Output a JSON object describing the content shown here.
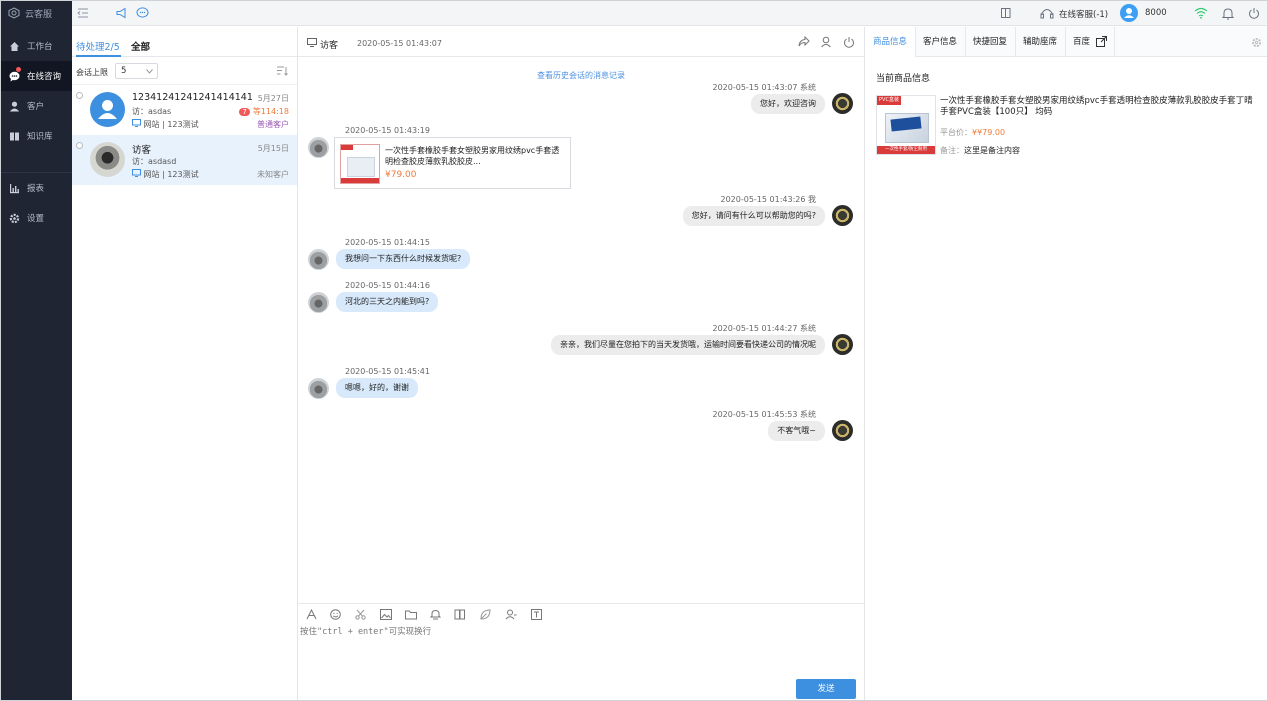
{
  "nav": {
    "brand": "云客服",
    "items": [
      {
        "label": "工作台",
        "icon": "home-icon"
      },
      {
        "label": "在线咨询",
        "icon": "chat-icon"
      },
      {
        "label": "客户",
        "icon": "user-icon"
      },
      {
        "label": "知识库",
        "icon": "book-icon"
      },
      {
        "label": "报表",
        "icon": "chart-icon"
      },
      {
        "label": "设置",
        "icon": "gear-icon"
      }
    ]
  },
  "topbar": {
    "agent_status": "在线客服(-1)",
    "agent_id": "8000"
  },
  "sessions": {
    "tab_pending": "待处理2/5",
    "tab_all": "全部",
    "limit_label": "会话上限",
    "limit_value": "5",
    "items": [
      {
        "name": "12341241241241414141",
        "visitor": "访：asdas",
        "source": "网站 | 123测试",
        "date": "5月27日",
        "badge": "7",
        "wait": "等114:18",
        "type": "普通客户",
        "type_color": "#9b59b6"
      },
      {
        "name": "访客",
        "visitor": "访：asdasd",
        "source": "网站 | 123测试",
        "date": "5月15日",
        "badge": "",
        "wait": "",
        "type": "未知客户",
        "type_color": "#888888"
      }
    ]
  },
  "chat": {
    "title": "访客",
    "started": "2020-05-15 01:43:07",
    "history_link": "查看历史会话的消息记录",
    "messages": [
      {
        "dir": "out",
        "time": "2020-05-15 01:43:07 系统",
        "text": "您好，欢迎咨询"
      },
      {
        "dir": "in",
        "time": "2020-05-15 01:43:19",
        "card": {
          "title": "一次性手套橡胶手套女塑胶男家用纹绣pvc手套透明检查胶皮薄款乳胶胶皮...",
          "price": "¥79.00"
        }
      },
      {
        "dir": "out",
        "time": "2020-05-15 01:43:26 我",
        "text": "您好，请问有什么可以帮助您的吗?"
      },
      {
        "dir": "in",
        "time": "2020-05-15 01:44:15",
        "text": "我想问一下东西什么时候发货呢?"
      },
      {
        "dir": "in",
        "time": "2020-05-15 01:44:16",
        "text": "河北的三天之内能到吗?"
      },
      {
        "dir": "out",
        "time": "2020-05-15 01:44:27 系统",
        "text": "亲亲，我们尽量在您拍下的当天发货哦，运输时间要看快递公司的情况呢"
      },
      {
        "dir": "in",
        "time": "2020-05-15 01:45:41",
        "text": "嗯嗯，好的，谢谢"
      },
      {
        "dir": "out",
        "time": "2020-05-15 01:45:53 系统",
        "text": "不客气哦~"
      }
    ],
    "input_hint": "按住\"ctrl + enter\"可实现换行",
    "send_label": "发送"
  },
  "right": {
    "tabs": [
      "商品信息",
      "客户信息",
      "快捷回复",
      "辅助座席",
      "百度"
    ],
    "section_title": "当前商品信息",
    "product": {
      "name": "一次性手套橡胶手套女塑胶男家用纹绣pvc手套透明检查胶皮薄款乳胶胶皮手套丁晴手套PVC盒装【100只】 均码",
      "price_label": "平台价：",
      "price": "¥¥79.00",
      "note_label": "备注：",
      "note": "这里是备注内容",
      "image_tag": "PVC盒装",
      "image_footer": "一次性手套/防尘耐用"
    }
  },
  "colors": {
    "accent": "#3d8fe0",
    "nav_bg": "#1f2533",
    "warn": "#f07b3c"
  }
}
